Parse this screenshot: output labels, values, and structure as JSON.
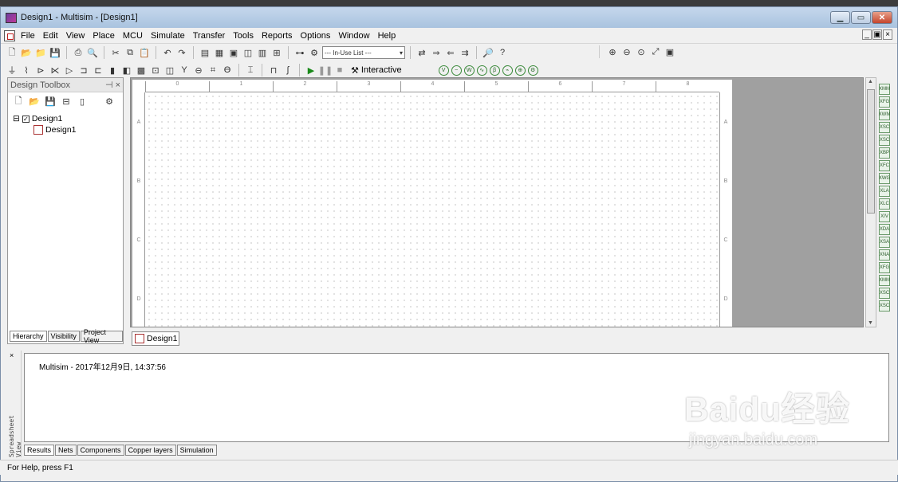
{
  "window": {
    "title": "Design1 - Multisim - [Design1]"
  },
  "menu": [
    "File",
    "Edit",
    "View",
    "Place",
    "MCU",
    "Simulate",
    "Transfer",
    "Tools",
    "Reports",
    "Options",
    "Window",
    "Help"
  ],
  "toolbar": {
    "inuse_list": "--- In-Use List ---",
    "interactive_label": "Interactive"
  },
  "toolbox": {
    "title": "Design Toolbox",
    "tree": {
      "root": "Design1",
      "child": "Design1"
    },
    "tabs": [
      "Hierarchy",
      "Visibility",
      "Project View"
    ]
  },
  "workspace": {
    "ruler_labels": [
      "0",
      "1",
      "2",
      "3",
      "4",
      "5",
      "6",
      "7",
      "8"
    ],
    "zones": [
      "A",
      "B",
      "C",
      "D"
    ],
    "doc_tab": "Design1"
  },
  "spreadsheet": {
    "side_label": "Spreadsheet View",
    "log_line": "Multisim  -  2017年12月9日, 14:37:56",
    "tabs": [
      "Results",
      "Nets",
      "Components",
      "Copper layers",
      "Simulation"
    ]
  },
  "status": {
    "help_text": "For Help, press F1"
  },
  "watermark": {
    "brand": "Baidu经验",
    "url": "jingyan.baidu.com"
  }
}
